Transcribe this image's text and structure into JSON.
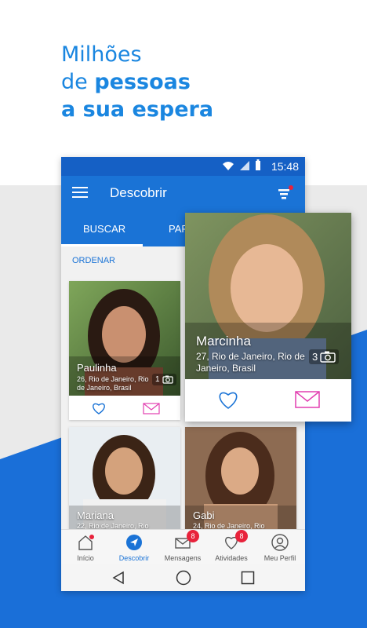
{
  "headline": {
    "line1": "Milhões",
    "line2_prefix": "de ",
    "line2_bold": "pessoas",
    "line3": "a sua espera"
  },
  "status": {
    "time": "15:48"
  },
  "appbar": {
    "title": "Descobrir"
  },
  "tabs": [
    {
      "label": "BUSCAR"
    },
    {
      "label": "PAR"
    }
  ],
  "sort": {
    "label": "ORDENAR"
  },
  "profiles": [
    {
      "name": "Paulinha",
      "location": "26, Rio de Janeiro, Rio de Janeiro, Brasil",
      "photos": "1"
    },
    {
      "name": "Mariana",
      "location": "22, Rio de Janeiro, Rio",
      "photos": ""
    },
    {
      "name": "Gabi",
      "location": "24, Rio de Janeiro, Rio",
      "photos": ""
    }
  ],
  "featured": {
    "name": "Marcinha",
    "location": "27, Rio de Janeiro, Rio de Janeiro, Brasil",
    "photos": "3"
  },
  "bottom_nav": [
    {
      "label": "Início"
    },
    {
      "label": "Descobrir"
    },
    {
      "label": "Mensagens",
      "badge": "8"
    },
    {
      "label": "Atividades",
      "badge": "8"
    },
    {
      "label": "Meu Perfil"
    }
  ],
  "colors": {
    "brand": "#1a73d6",
    "accent_text": "#1a86e0",
    "heart": "#1a73d6",
    "message": "#e23fb0",
    "badge": "#e8223b"
  }
}
